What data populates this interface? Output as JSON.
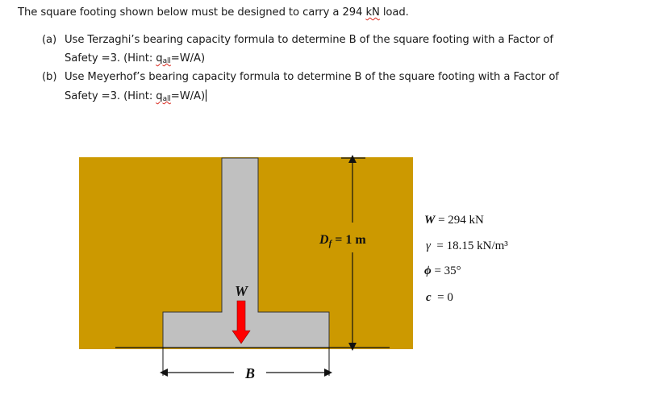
{
  "problem": {
    "intro_before": "The square footing shown below must be designed to carry a 294 ",
    "intro_unit": "kN",
    "intro_after": " load.",
    "items": [
      {
        "number": "(a)",
        "line1": "Use Terzaghi’s bearing capacity formula to determine B of the square footing with a Factor of",
        "line2_before": "Safety =3. (Hint: ",
        "q_symbol": "q",
        "q_subscript": "all",
        "line2_after": "=W/A)"
      },
      {
        "number": "(b)",
        "line1": "Use Meyerhof’s bearing capacity formula to determine B of the square footing with a Factor of",
        "line2_before": "Safety =3. (Hint: ",
        "q_symbol": "q",
        "q_subscript": "all",
        "line2_after": "=W/A)"
      }
    ]
  },
  "diagram": {
    "colors": {
      "soil": "#cc9900",
      "concrete": "#c0c0c0",
      "outline": "#333333",
      "load_arrow": "#ff0000",
      "dimension": "#111111"
    },
    "load_label": "W",
    "depth_label_main": "D",
    "depth_label_sub": "f",
    "depth_label_rest": " = 1 m",
    "width_label": "B",
    "parameters": [
      {
        "symbol": "W",
        "text": " = 294 kN"
      },
      {
        "symbol": "γ",
        "text": "  = 18.15 kN/m³"
      },
      {
        "symbol": "ϕ",
        "text": " = 35°"
      },
      {
        "symbol": "c",
        "text": "  = 0"
      }
    ]
  }
}
